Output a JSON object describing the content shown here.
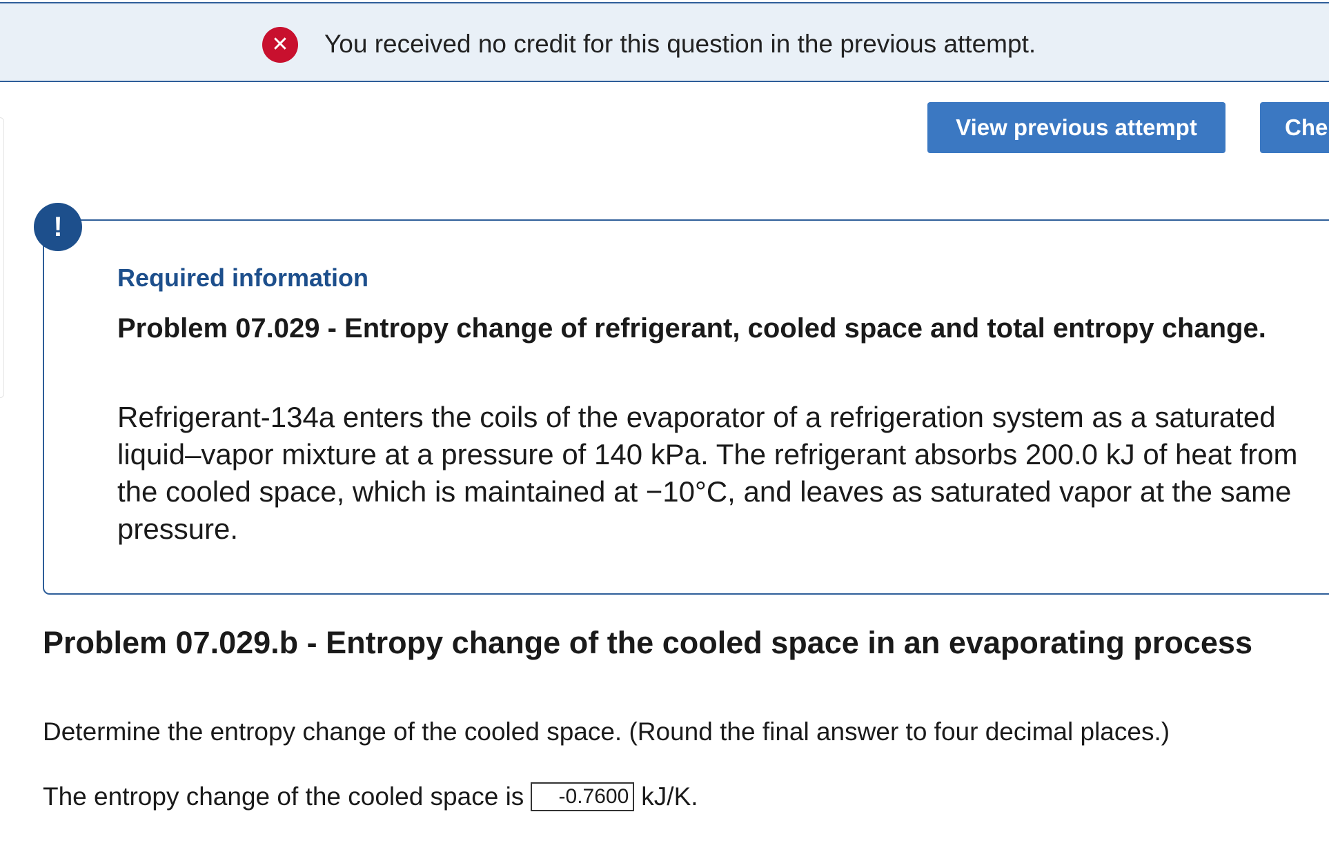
{
  "alert": {
    "icon": "error-x-icon",
    "message": "You received no credit for this question in the previous attempt.",
    "color": "#c8102e",
    "background": "#e9f0f7"
  },
  "actions": {
    "view_previous": "View previous attempt",
    "check": "Che"
  },
  "required_info": {
    "icon": "exclamation-icon",
    "title": "Required information",
    "heading": "Problem 07.029 - Entropy change of refrigerant, cooled space and total entropy change.",
    "body": "Refrigerant-134a enters the coils of the evaporator of a refrigeration system as a saturated liquid–vapor mixture at a pressure of 140 kPa. The refrigerant absorbs 200.0 kJ of heat from the cooled space, which is maintained at −10°C, and leaves as saturated vapor at the same pressure."
  },
  "part_b": {
    "heading": "Problem 07.029.b - Entropy change of the cooled space in an evaporating process",
    "prompt": "Determine the entropy change of the cooled space. (Round the final answer to four decimal places.)",
    "answer_prefix": "The entropy change of the cooled space is",
    "answer_value": "-0.7600",
    "answer_unit": "kJ/K."
  },
  "colors": {
    "accent": "#3b78c2",
    "border": "#2e5e99",
    "info_icon": "#1d4f8c"
  }
}
